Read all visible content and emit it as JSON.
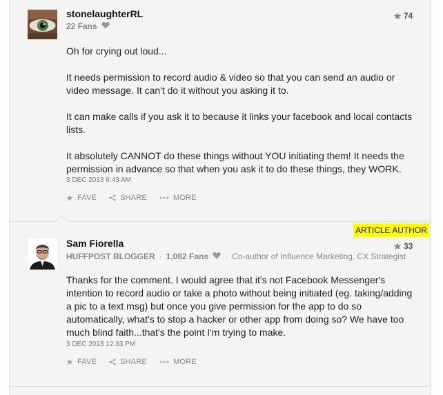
{
  "comments": [
    {
      "username": "stonelaughterRL",
      "fans": "22 Fans",
      "stars": "74",
      "body": [
        "Oh for crying out loud...",
        "It needs permission to record audio & video so that you can send an audio or video message. It can't do it without you asking it to.",
        "It can make calls if you ask it to because it links your facebook and local contacts lists.",
        "It absolutely CANNOT do these things without YOU initiating them! It needs the permission in advance so that when you ask it to do these things, they WORK."
      ],
      "date": "3 DEC 2013 6:43 AM",
      "actions": {
        "fave": "FAVE",
        "share": "SHARE",
        "more": "MORE"
      }
    },
    {
      "badge": "ARTICLE AUTHOR",
      "username": "Sam Fiorella",
      "role": "HUFFPOST BLOGGER",
      "fans": "1,082 Fans",
      "bio": "Co-author of Influence Marketing, CX Strategist",
      "stars": "33",
      "body": [
        "Thanks for the comment. I would agree that it's not Facebook Messenger's intention to record audio or take a photo without being initiated (eg. taking/adding a pic to a text msg) but once you give permission for the app to do so automatically, what's to stop a hacker or other app from doing so? We have too much blind faith...that's the point I'm trying to make."
      ],
      "date": "3 DEC 2013 12:33 PM",
      "actions": {
        "fave": "FAVE",
        "share": "SHARE",
        "more": "MORE"
      }
    }
  ],
  "icons": {
    "star": "star-icon",
    "heart": "heart-icon",
    "share": "share-icon",
    "more": "more-dots-icon"
  },
  "colors": {
    "badge": "#ffff00",
    "panel": "#f4f4f4",
    "meta": "#888888"
  }
}
